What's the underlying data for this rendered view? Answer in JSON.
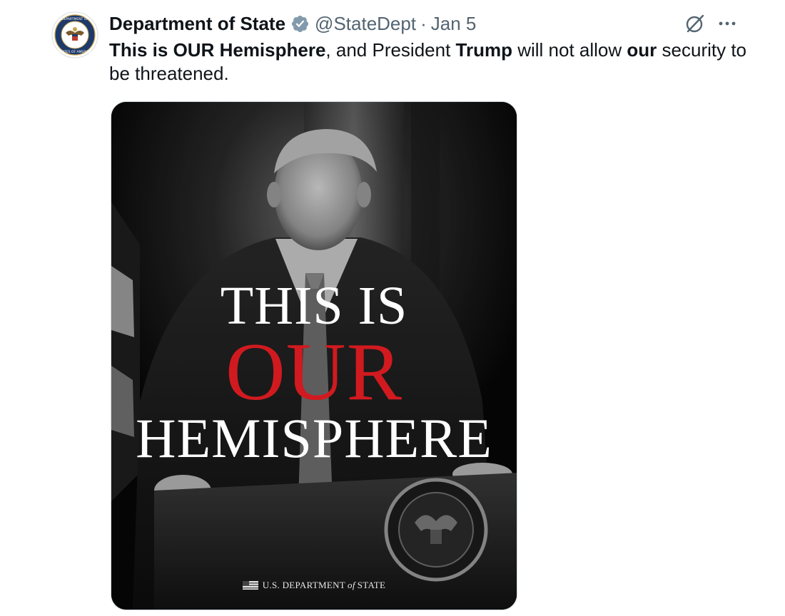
{
  "tweet": {
    "display_name": "Department of State",
    "handle": "@StateDept",
    "separator": "·",
    "date": "Jan 5",
    "text_parts": [
      {
        "text": "This is OUR Hemisphere",
        "bold": true
      },
      {
        "text": ", and President ",
        "bold": false
      },
      {
        "text": "Trump",
        "bold": true
      },
      {
        "text": " will not allow ",
        "bold": false
      },
      {
        "text": "our",
        "bold": true
      },
      {
        "text": " security to be threatened.",
        "bold": false
      }
    ]
  },
  "icons": {
    "avatar": "department-of-state-seal",
    "verified": "verified-badge-icon",
    "grok": "grok-icon",
    "more": "more-options-icon"
  },
  "colors": {
    "text_primary": "#0f1419",
    "text_secondary": "#536471",
    "verified_badge": "#829aab",
    "poster_red": "#d11a1f",
    "poster_white": "#ffffff"
  },
  "poster": {
    "line1": "THIS IS",
    "line2": "OUR",
    "line3": "HEMISPHERE",
    "footer_prefix": "U.S. DEPARTMENT",
    "footer_of": "of",
    "footer_suffix": "STATE"
  }
}
